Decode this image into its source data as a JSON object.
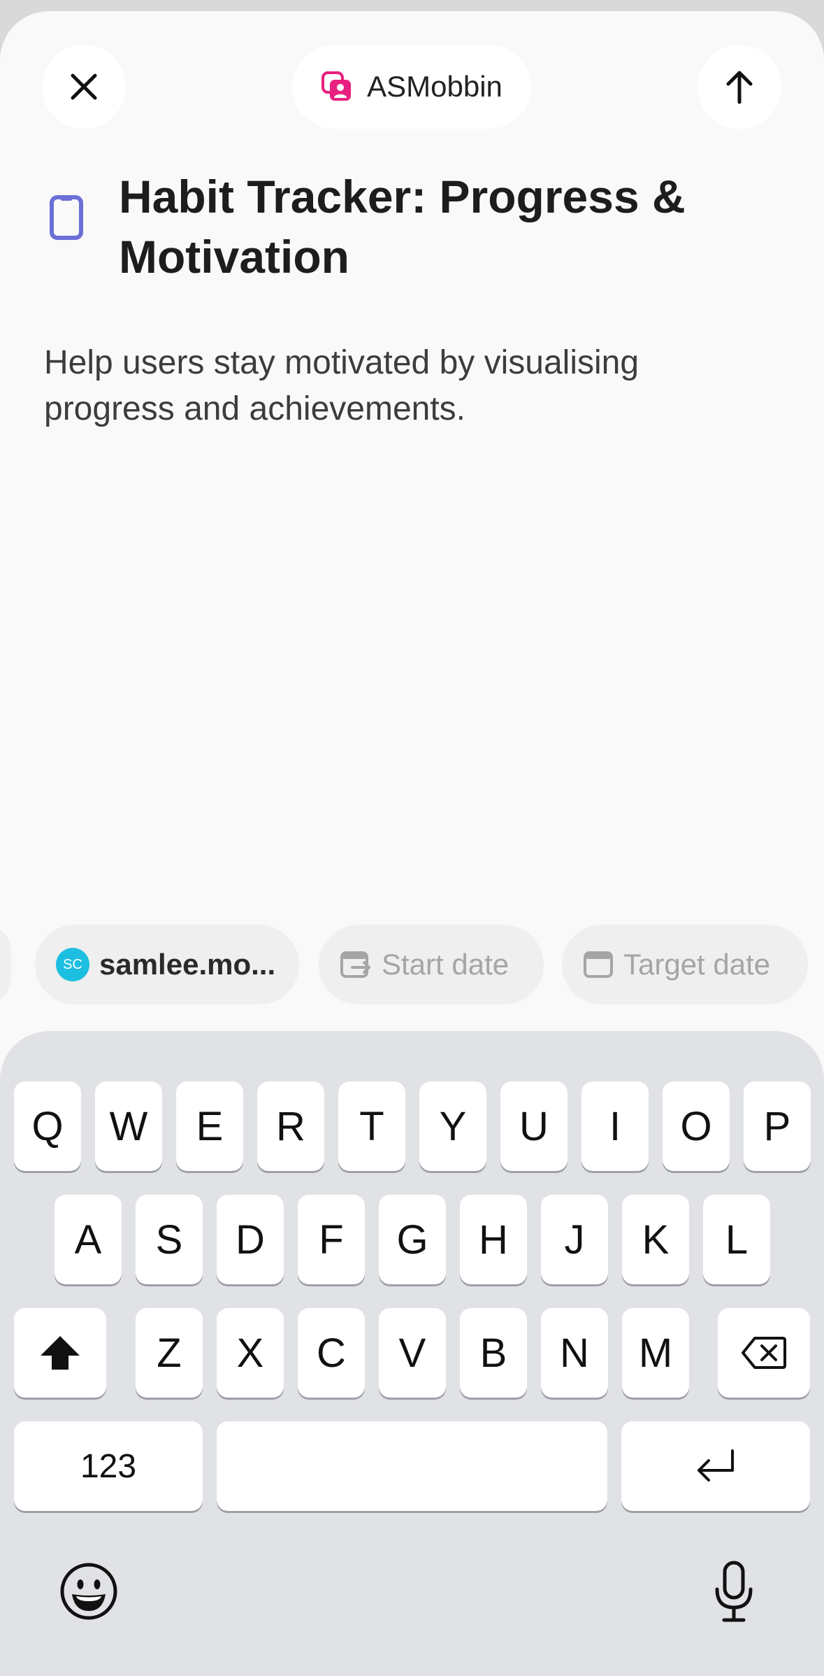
{
  "header": {
    "close_icon": "close-icon",
    "workspace_name": "ASMobbin",
    "workspace_icon": "workspace-icon",
    "workspace_color": "#e8207f",
    "submit_icon": "arrow-up-icon"
  },
  "project": {
    "icon": "phone-icon",
    "icon_color": "#6b6fd6",
    "title": "Habit Tracker: Progress & Motivation",
    "description": "Help users stay motivated by visualising progress and achievements."
  },
  "chips": {
    "assignee_initials": "SC",
    "assignee_label": "samlee.mo...",
    "start_date_label": "Start date",
    "target_date_label": "Target date"
  },
  "keyboard": {
    "row1": [
      "Q",
      "W",
      "E",
      "R",
      "T",
      "Y",
      "U",
      "I",
      "O",
      "P"
    ],
    "row2": [
      "A",
      "S",
      "D",
      "F",
      "G",
      "H",
      "J",
      "K",
      "L"
    ],
    "row3": [
      "Z",
      "X",
      "C",
      "V",
      "B",
      "N",
      "M"
    ],
    "numbers_label": "123",
    "shift_icon": "shift-icon",
    "delete_icon": "delete-icon",
    "return_icon": "return-icon",
    "emoji_icon": "emoji-icon",
    "mic_icon": "microphone-icon"
  }
}
